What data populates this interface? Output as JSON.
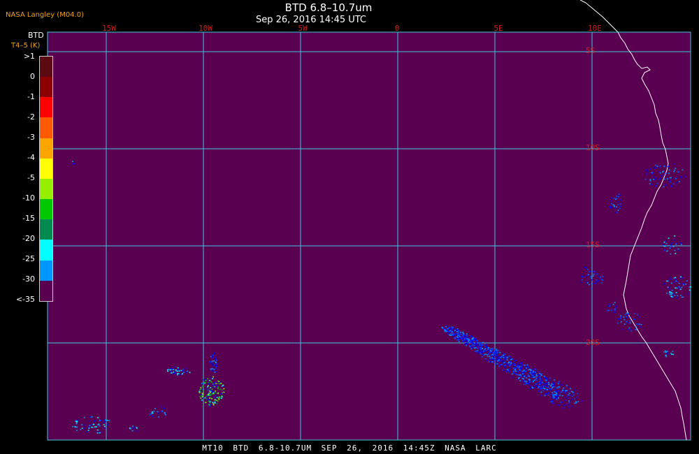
{
  "header": {
    "title": "BTD 6.8–10.7um",
    "datetime": "Sep 26, 2016 14:45 UTC",
    "credit": "NASA Langley (M04.0)"
  },
  "legend": {
    "title": "BTD",
    "unit": "T4–5 (K)",
    "ticks": [
      ">1",
      "0",
      "-1",
      "-2",
      "-3",
      "-4",
      "-5",
      "-10",
      "-15",
      "-20",
      "-25",
      "-30",
      "<-35"
    ],
    "colors": [
      "#5a0a10",
      "#8b0000",
      "#ff0000",
      "#ff5a00",
      "#ffa500",
      "#ffff00",
      "#96ee00",
      "#00c800",
      "#008a50",
      "#00ffff",
      "#0096ff",
      "#0000ff",
      "#5a0050"
    ]
  },
  "grid": {
    "lon_labels": [
      "15W",
      "10W",
      "5W",
      "0",
      "5E",
      "10E"
    ],
    "lat_labels": [
      "5S",
      "10S",
      "15S",
      "20S"
    ]
  },
  "footer": {
    "text": "MT10  BTD 6.8-10.7UM  SEP 26, 2016 14:45Z  NASA LARC"
  },
  "colors": {
    "background": "#5a0050",
    "gridline": "#40c8e0",
    "coastline": "#ffffff",
    "grid_label": "#d02020"
  }
}
